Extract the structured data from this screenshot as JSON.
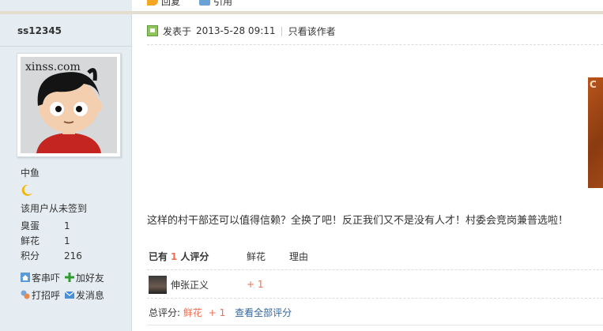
{
  "top_actions": [
    {
      "label": "回复",
      "icon": "reply-icon"
    },
    {
      "label": "引用",
      "icon": "quote-icon"
    }
  ],
  "author": {
    "username": "ss12345",
    "avatar_text": "xinss.com",
    "rank": "中鱼",
    "sign_status": "该用户从未签到",
    "stats": [
      {
        "label": "臭蛋",
        "value": "1"
      },
      {
        "label": "鲜花",
        "value": "1"
      },
      {
        "label": "积分",
        "value": "216"
      }
    ],
    "actions": [
      {
        "label": "客串吓",
        "icon": "home-icon"
      },
      {
        "label": "加好友",
        "icon": "plus-icon"
      },
      {
        "label": "打招呼",
        "icon": "greet-icon"
      },
      {
        "label": "发消息",
        "icon": "mail-icon"
      }
    ]
  },
  "post": {
    "posted_label": "发表于",
    "posted_time": "2013-5-28 09:11",
    "only_author": "只看该作者",
    "side_image_text": "C",
    "body": "这样的村干部还可以值得信赖？全换了吧！反正我们又不是没有人才！村委会竞岗兼普选啦！"
  },
  "rating": {
    "header_prefix": "已有",
    "count": "1",
    "header_suffix": "人评分",
    "col_flower": "鲜花",
    "col_reason": "理由",
    "raters": [
      {
        "name": "伸张正义",
        "score": "+ 1"
      }
    ],
    "total_label": "总评分:",
    "total_item": "鲜花",
    "total_score": "+ 1",
    "view_all": "查看全部评分"
  }
}
